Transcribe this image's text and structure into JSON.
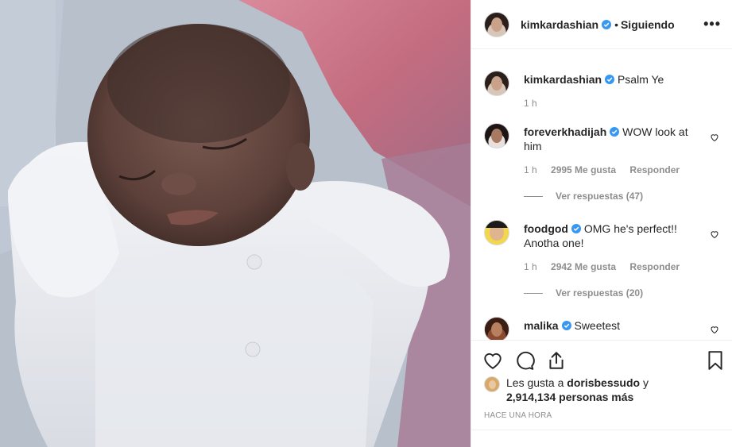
{
  "post": {
    "author": "kimkardashian",
    "separator": "•",
    "follow_state": "Siguiendo",
    "more_icon": "more-options-icon",
    "verified_color": "#3897f0"
  },
  "comments": [
    {
      "user": "kimkardashian",
      "text": "Psalm Ye",
      "time": "1 h",
      "likes": "",
      "reply": "",
      "view_replies": ""
    },
    {
      "user": "foreverkhadijah",
      "text": "WOW look at him",
      "time": "1 h",
      "likes": "2995 Me gusta",
      "reply": "Responder",
      "view_replies": "Ver respuestas (47)"
    },
    {
      "user": "foodgod",
      "text": "OMG he's perfect!! Anotha one!",
      "time": "1 h",
      "likes": "2942 Me gusta",
      "reply": "Responder",
      "view_replies": "Ver respuestas (20)"
    },
    {
      "user": "malika",
      "text": "Sweetest",
      "time": "",
      "likes": "",
      "reply": "",
      "view_replies": ""
    }
  ],
  "actions": {
    "like_icon": "heart-icon",
    "comment_icon": "comment-icon",
    "share_icon": "share-icon",
    "save_icon": "bookmark-icon"
  },
  "likes": {
    "prefix": "Les gusta a",
    "user": "dorisbessudo",
    "conj": "y",
    "count": "2,914,134 personas más"
  },
  "timestamp": "HACE UNA HORA"
}
